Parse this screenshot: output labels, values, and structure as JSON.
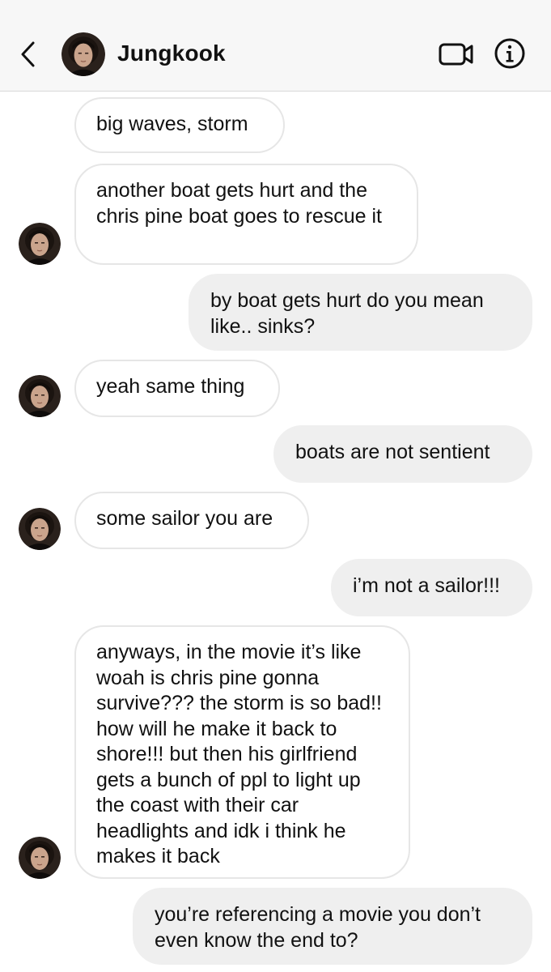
{
  "header": {
    "contact_name": "Jungkook",
    "back_icon": "chevron-left-icon",
    "video_icon": "video-camera-icon",
    "info_icon": "info-icon"
  },
  "messages": [
    {
      "from": "them",
      "text": "big waves, storm"
    },
    {
      "from": "them",
      "text": "another boat gets hurt and the chris pine boat goes to rescue it"
    },
    {
      "from": "me",
      "text": "by boat gets hurt do you mean like.. sinks?"
    },
    {
      "from": "them",
      "text": "yeah same thing"
    },
    {
      "from": "me",
      "text": "boats are not sentient"
    },
    {
      "from": "them",
      "text": "some sailor you are"
    },
    {
      "from": "me",
      "text": "i’m not a sailor!!!"
    },
    {
      "from": "them",
      "text": "anyways, in the movie it’s like woah is chris pine gonna survive??? the storm is so bad!! how will he make it back to shore!!! but then his girlfriend gets a bunch of ppl to light up the coast with their car headlights and idk i think he makes it back"
    },
    {
      "from": "me",
      "text": "you’re referencing a movie you don’t even know the end to?"
    }
  ],
  "colors": {
    "header_bg": "#f7f7f7",
    "incoming_border": "#e6e6e6",
    "outgoing_bg": "#efefef",
    "text": "#111111"
  }
}
